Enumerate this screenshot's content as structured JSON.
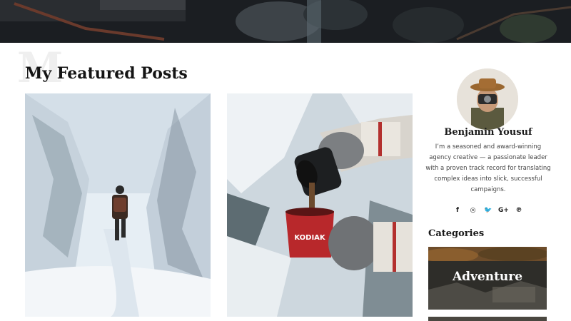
{
  "featured": {
    "watermark": "M",
    "title": "My Featured Posts"
  },
  "author": {
    "name": "Benjamin Yousuf",
    "bio": "I’m a seasoned and award-winning agency creative — a passionate leader with a proven track record for translating complex ideas into slick, successful campaigns."
  },
  "social": [
    {
      "icon": "facebook-icon",
      "glyph": "f"
    },
    {
      "icon": "instagram-icon",
      "glyph": "◎"
    },
    {
      "icon": "twitter-icon",
      "glyph": "🐦"
    },
    {
      "icon": "google-plus-icon",
      "glyph": "G+"
    },
    {
      "icon": "pinterest-icon",
      "glyph": "℗"
    }
  ],
  "categories": {
    "title": "Categories",
    "items": [
      {
        "label": "Adventure"
      }
    ]
  },
  "mug_text": "KODIAK"
}
